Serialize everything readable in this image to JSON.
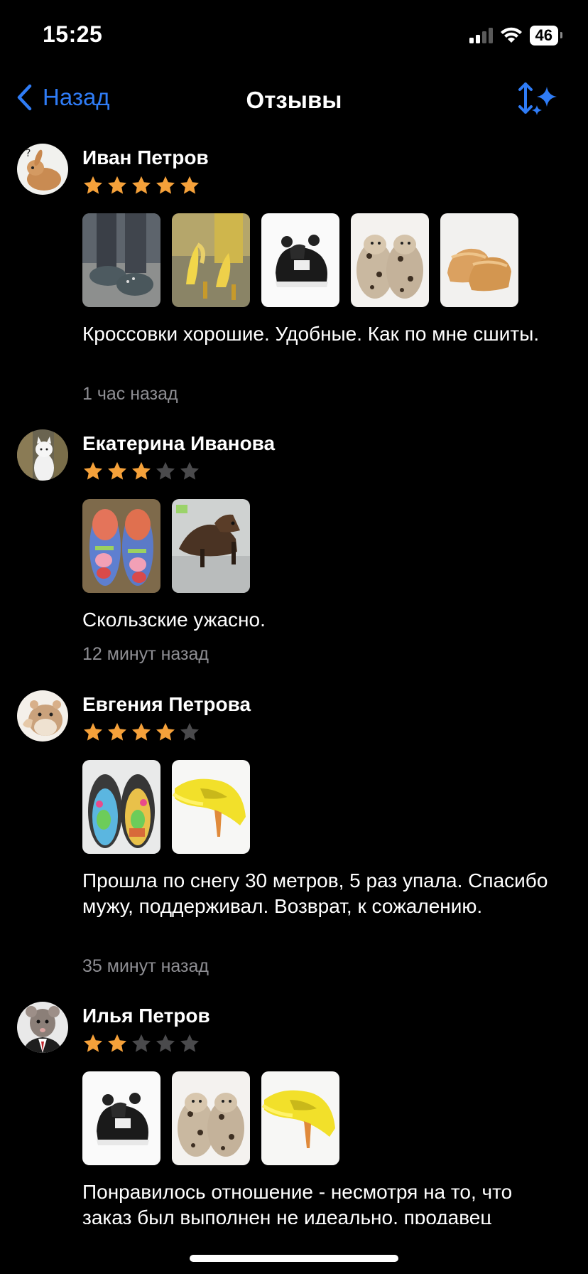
{
  "status": {
    "time": "15:25",
    "battery": "46"
  },
  "nav": {
    "back_label": "Назад",
    "title": "Отзывы"
  },
  "colors": {
    "accent": "#2f7cf6",
    "star_filled": "#f5a13a",
    "star_empty": "#4a4a4c",
    "secondary_text": "#8e8e93"
  },
  "reviews": [
    {
      "name": "Иван Петров",
      "rating": 5,
      "photos": [
        "dino-feet-boots",
        "banana-heels",
        "black-white-sneakers",
        "leopard-slippers",
        "fluffy-slippers"
      ],
      "text": "Кроссовки хорошие. Удобные. Как по мне сшиты.",
      "time": "1 час назад"
    },
    {
      "name": "Екатерина Иванова",
      "rating": 3,
      "photos": [
        "peppa-pig-slip-ons",
        "horse-head-heels"
      ],
      "text": "Скользские ужасно.",
      "time": "12 минут назад"
    },
    {
      "name": "Евгения Петрова",
      "rating": 4,
      "photos": [
        "painted-slip-ons",
        "yellow-fluffy-heels"
      ],
      "text": "Прошла по снегу 30 метров, 5 раз упала. Спасибо мужу, поддерживал. Возврат, к сожалению.",
      "time": "35 минут назад"
    },
    {
      "name": "Илья Петров",
      "rating": 2,
      "photos": [
        "black-white-sneakers",
        "leopard-slippers",
        "yellow-fluffy-heels"
      ],
      "text": "Понравилось отношение - несмотря на то, что заказ был выполнен не идеально, продавец",
      "time": ""
    }
  ]
}
